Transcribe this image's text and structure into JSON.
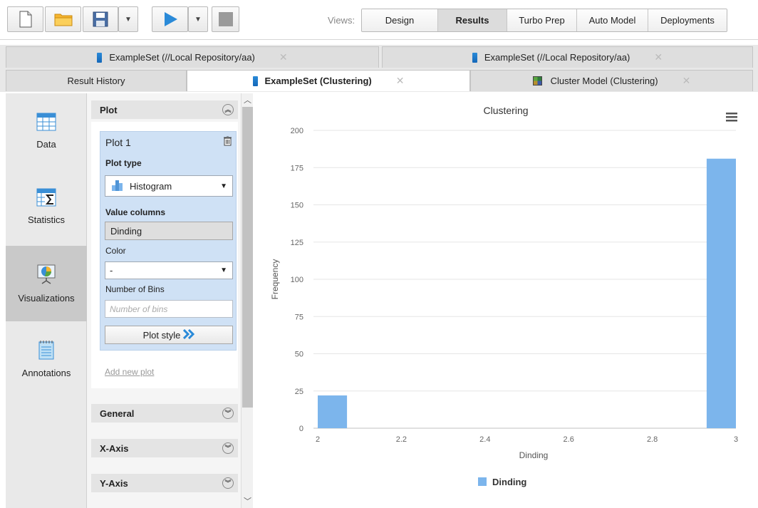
{
  "toolbar": {
    "views_label": "Views:",
    "views": [
      "Design",
      "Results",
      "Turbo Prep",
      "Auto Model",
      "Deployments"
    ],
    "active_view": "Results"
  },
  "tabs": {
    "row1": [
      {
        "label": "ExampleSet (//Local Repository/aa)"
      },
      {
        "label": "ExampleSet (//Local Repository/aa)"
      }
    ],
    "row2": [
      {
        "label": "Result History"
      },
      {
        "label": "ExampleSet (Clustering)"
      },
      {
        "label": "Cluster Model (Clustering)"
      }
    ],
    "close_glyph": "✕"
  },
  "leftnav": {
    "items": [
      {
        "label": "Data",
        "icon": "table-icon"
      },
      {
        "label": "Statistics",
        "icon": "statistics-icon"
      },
      {
        "label": "Visualizations",
        "icon": "visualization-icon"
      },
      {
        "label": "Annotations",
        "icon": "notepad-icon"
      }
    ],
    "active": "Visualizations"
  },
  "config": {
    "plot_section": "Plot",
    "plot_title": "Plot 1",
    "plot_type_label": "Plot type",
    "plot_type_value": "Histogram",
    "value_columns_label": "Value columns",
    "value_column": "Dinding",
    "color_label": "Color",
    "color_value": "-",
    "bins_label": "Number of Bins",
    "bins_placeholder": "Number of bins",
    "plot_style": "Plot style",
    "add_new_plot": "Add new plot",
    "sections": [
      "General",
      "X-Axis",
      "Y-Axis"
    ]
  },
  "colors": {
    "bar": "#7cb5ec",
    "panel_active": "#cfe1f5"
  },
  "chart_data": {
    "type": "bar",
    "title": "Clustering",
    "xlabel": "Dinding",
    "ylabel": "Frequency",
    "bins": [
      {
        "x0": 2.0,
        "x1": 2.07,
        "count": 22
      },
      {
        "x0": 2.93,
        "x1": 3.0,
        "count": 181
      }
    ],
    "xlim": [
      2,
      3
    ],
    "xticks": [
      "2",
      "2.2",
      "2.4",
      "2.6",
      "2.8",
      "3"
    ],
    "ylim": [
      0,
      200
    ],
    "yticks": [
      "0",
      "25",
      "50",
      "75",
      "100",
      "125",
      "150",
      "175",
      "200"
    ],
    "legend": [
      {
        "name": "Dinding"
      }
    ],
    "legend_position": "bottom-center",
    "grid": true
  }
}
